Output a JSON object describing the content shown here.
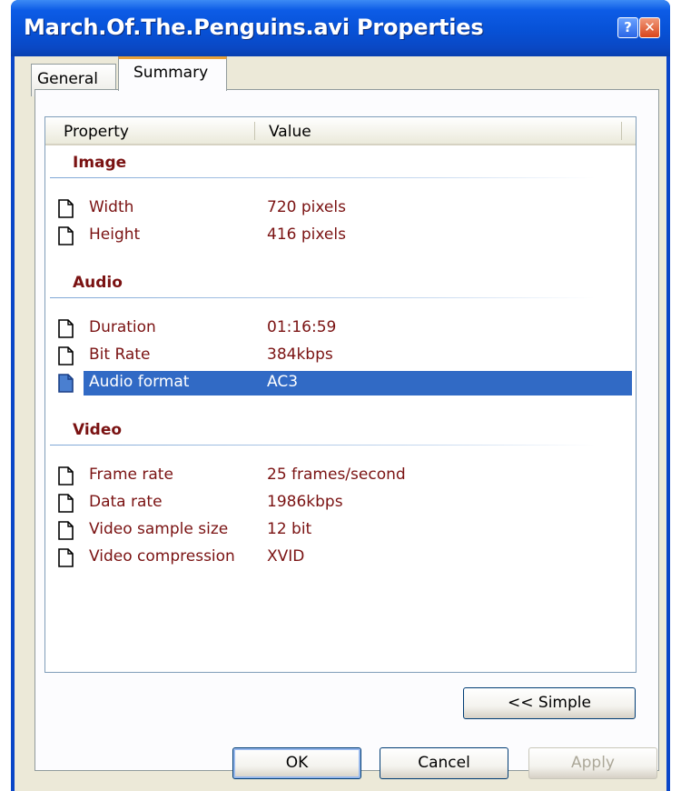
{
  "window": {
    "title": "March.Of.The.Penguins.avi Properties",
    "help_label": "?",
    "close_label": "✕"
  },
  "tabs": [
    {
      "label": "General"
    },
    {
      "label": "Summary"
    }
  ],
  "list": {
    "columns": [
      "Property",
      "Value"
    ],
    "groups": [
      {
        "title": "Image",
        "rows": [
          {
            "name": "Width",
            "value": "720 pixels"
          },
          {
            "name": "Height",
            "value": "416 pixels"
          }
        ]
      },
      {
        "title": "Audio",
        "rows": [
          {
            "name": "Duration",
            "value": "01:16:59"
          },
          {
            "name": "Bit Rate",
            "value": "384kbps"
          },
          {
            "name": "Audio format",
            "value": "AC3"
          }
        ]
      },
      {
        "title": "Video",
        "rows": [
          {
            "name": "Frame rate",
            "value": "25 frames/second"
          },
          {
            "name": "Data rate",
            "value": "1986kbps"
          },
          {
            "name": "Video sample size",
            "value": "12 bit"
          },
          {
            "name": "Video compression",
            "value": "XVID"
          }
        ]
      }
    ]
  },
  "buttons": {
    "simple": "<< Simple",
    "ok": "OK",
    "cancel": "Cancel",
    "apply": "Apply"
  },
  "colors": {
    "titlebar": "#0a46c8",
    "selection": "#316ac5",
    "group_text": "#7a1212"
  }
}
